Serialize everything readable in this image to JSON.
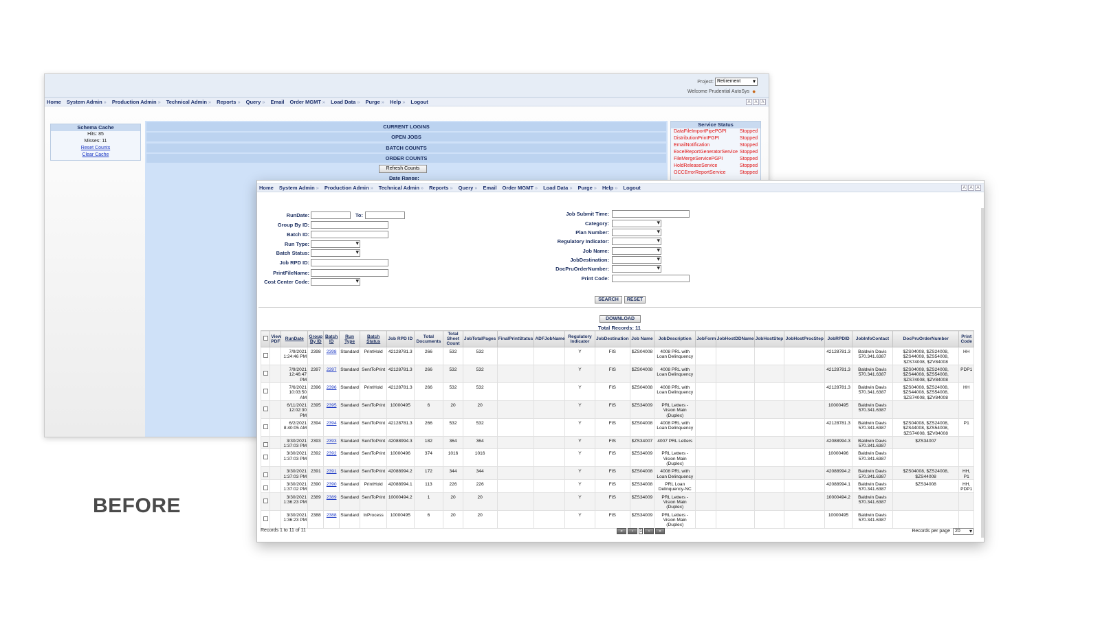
{
  "label": "BEFORE",
  "nav": [
    {
      "label": "Home",
      "arrow": false
    },
    {
      "label": "System Admin",
      "arrow": true
    },
    {
      "label": "Production Admin",
      "arrow": true
    },
    {
      "label": "Technical Admin",
      "arrow": true
    },
    {
      "label": "Reports",
      "arrow": true
    },
    {
      "label": "Query",
      "arrow": true
    },
    {
      "label": "Email",
      "arrow": false
    },
    {
      "label": "Order MGMT",
      "arrow": true
    },
    {
      "label": "Load Data",
      "arrow": true
    },
    {
      "label": "Purge",
      "arrow": true
    },
    {
      "label": "Help",
      "arrow": true
    },
    {
      "label": "Logout",
      "arrow": false
    }
  ],
  "back": {
    "project_label": "Project:",
    "project_value": "Retirement",
    "welcome": "Welcome  Prudential AutoSys",
    "schema_cache": {
      "title": "Schema Cache",
      "hits": "Hits: 85",
      "misses": "Misses: 11",
      "reset": "Reset Counts",
      "clear": "Clear Cache"
    },
    "bars": [
      "CURRENT LOGINS",
      "OPEN JOBS",
      "BATCH COUNTS",
      "ORDER COUNTS"
    ],
    "refresh": "Refresh Counts",
    "date_range": "Date Range:",
    "service_status": {
      "title": "Service Status",
      "services": [
        {
          "name": "DataFileImportPipePGPI",
          "status": "Stopped"
        },
        {
          "name": "DistributionPrintPGPI",
          "status": "Stopped"
        },
        {
          "name": "EmailNotification",
          "status": "Stopped"
        },
        {
          "name": "ExcelReportGeneratorService",
          "status": "Stopped"
        },
        {
          "name": "FileMergeServicePGPI",
          "status": "Stopped"
        },
        {
          "name": "HoldReleaseService",
          "status": "Stopped"
        },
        {
          "name": "OCCErrorReportService",
          "status": "Stopped"
        }
      ]
    }
  },
  "form": {
    "run_date": "RunDate:",
    "to": "To:",
    "group_by_id": "Group By ID:",
    "batch_id": "Batch ID:",
    "run_type": "Run Type:",
    "batch_status": "Batch Status:",
    "job_rpd_id": "Job RPD ID:",
    "print_file_name": "PrintFileName:",
    "cost_center_code": "Cost Center Code:",
    "job_submit_time": "Job Submit Time:",
    "category": "Category:",
    "plan_number": "Plan Number:",
    "regulatory_indicator": "Regulatory Indicator:",
    "job_name": "Job Name:",
    "job_destination": "JobDestination:",
    "doc_pru_order_number": "DocPruOrderNumber:",
    "print_code": "Print Code:",
    "search": "SEARCH",
    "reset": "RESET",
    "download": "DOWNLOAD",
    "total_records": "Total Records: 11"
  },
  "table": {
    "headers": [
      "View PDF",
      "RunDate",
      "Group By ID",
      "Batch ID",
      "Run Type",
      "Batch Status",
      "Job RPD ID",
      "Total Documents",
      "Total Sheet Count",
      "JobTotalPages",
      "FinalPrintStatus",
      "ADFJobName",
      "Regulatory Indicator",
      "JobDestination",
      "Job Name",
      "JobDescription",
      "JobForm",
      "JobHostDDName",
      "JobHostStep",
      "JobHostProcStep",
      "JobRPDID",
      "JobInfoContact",
      "DocPruOrderNumber",
      "Print Code"
    ],
    "rows": [
      {
        "date": "7/9/2021",
        "time": "1:24:46 PM",
        "group": "2398",
        "batch": "2398",
        "type": "Standard",
        "status": "PrintHold",
        "rpd": "42128781.3",
        "docs": "266",
        "sheets": "532",
        "pages": "532",
        "reg": "Y",
        "dest": "FIS",
        "job": "$ZS04008",
        "desc": "4008 PRL with Loan Delinquency",
        "rpdid": "42128781.3",
        "contact": "Baldwin Davis 570.341.6387",
        "order": "$ZS04008, $ZS24008, $ZS44008, $ZS54008, $ZS74008, $ZV84008",
        "code": "HH"
      },
      {
        "date": "7/9/2021",
        "time": "12:46:47 PM",
        "group": "2397",
        "batch": "2397",
        "type": "Standard",
        "status": "SentToPrint",
        "rpd": "42128781.3",
        "docs": "266",
        "sheets": "532",
        "pages": "532",
        "reg": "Y",
        "dest": "FIS",
        "job": "$ZS04008",
        "desc": "4008 PRL with Loan Delinquency",
        "rpdid": "42128781.3",
        "contact": "Baldwin Davis 570.341.6387",
        "order": "$ZS04008, $ZS24008, $ZS44008, $ZS54008, $ZS74008, $ZV84008",
        "code": "PDP1"
      },
      {
        "date": "7/6/2021",
        "time": "10:03:50 AM",
        "group": "2396",
        "batch": "2396",
        "type": "Standard",
        "status": "PrintHold",
        "rpd": "42128781.3",
        "docs": "266",
        "sheets": "532",
        "pages": "532",
        "reg": "Y",
        "dest": "FIS",
        "job": "$ZS04008",
        "desc": "4008 PRL with Loan Delinquency",
        "rpdid": "42128781.3",
        "contact": "Baldwin Davis 570.341.6387",
        "order": "$ZS04008, $ZS24008, $ZS44008, $ZS54008, $ZS74008, $ZV84008",
        "code": "HH"
      },
      {
        "date": "6/11/2021",
        "time": "12:02:30 PM",
        "group": "2395",
        "batch": "2395",
        "type": "Standard",
        "status": "SentToPrint",
        "rpd": "10000495",
        "docs": "6",
        "sheets": "20",
        "pages": "20",
        "reg": "Y",
        "dest": "FIS",
        "job": "$ZS34009",
        "desc": "PRL Letters - Vision Main (Duplex)",
        "rpdid": "10000495",
        "contact": "Baldwin Davis 570.341.6387",
        "order": "",
        "code": ""
      },
      {
        "date": "6/2/2021",
        "time": "8:40:05 AM",
        "group": "2394",
        "batch": "2394",
        "type": "Standard",
        "status": "SentToPrint",
        "rpd": "42128781.3",
        "docs": "266",
        "sheets": "532",
        "pages": "532",
        "reg": "Y",
        "dest": "FIS",
        "job": "$ZS04008",
        "desc": "4008 PRL with Loan Delinquency",
        "rpdid": "42128781.3",
        "contact": "Baldwin Davis 570.341.6387",
        "order": "$ZS04008, $ZS24008, $ZS44008, $ZS54008, $ZS74008, $ZV84008",
        "code": "P1"
      },
      {
        "date": "3/30/2021",
        "time": "1:37:03 PM",
        "group": "2393",
        "batch": "2393",
        "type": "Standard",
        "status": "SentToPrint",
        "rpd": "42088994.3",
        "docs": "182",
        "sheets": "364",
        "pages": "364",
        "reg": "Y",
        "dest": "FIS",
        "job": "$ZS34007",
        "desc": "4007 PRL Letters",
        "rpdid": "42088994.3",
        "contact": "Baldwin Davis 570.341.6387",
        "order": "$ZS34007",
        "code": ""
      },
      {
        "date": "3/30/2021",
        "time": "1:37:03 PM",
        "group": "2392",
        "batch": "2392",
        "type": "Standard",
        "status": "SentToPrint",
        "rpd": "10000496",
        "docs": "374",
        "sheets": "1016",
        "pages": "1016",
        "reg": "Y",
        "dest": "FIS",
        "job": "$ZS34009",
        "desc": "PRL Letters - Vision Main (Duplex)",
        "rpdid": "10000496",
        "contact": "Baldwin Davis 570.341.6387",
        "order": "",
        "code": ""
      },
      {
        "date": "3/30/2021",
        "time": "1:37:03 PM",
        "group": "2391",
        "batch": "2391",
        "type": "Standard",
        "status": "SentToPrint",
        "rpd": "42088994.2",
        "docs": "172",
        "sheets": "344",
        "pages": "344",
        "reg": "Y",
        "dest": "FIS",
        "job": "$ZS04008",
        "desc": "4008 PRL with Loan Delinquency",
        "rpdid": "42088994.2",
        "contact": "Baldwin Davis 570.341.6387",
        "order": "$ZS04008, $ZS24008, $ZS44008",
        "code": "HH, P1"
      },
      {
        "date": "3/30/2021",
        "time": "1:37:02 PM",
        "group": "2390",
        "batch": "2390",
        "type": "Standard",
        "status": "PrintHold",
        "rpd": "42088994.1",
        "docs": "113",
        "sheets": "226",
        "pages": "226",
        "reg": "Y",
        "dest": "FIS",
        "job": "$ZS34008",
        "desc": "PRL Loan Delinquency-NC",
        "rpdid": "42088994.1",
        "contact": "Baldwin Davis 570.341.6387",
        "order": "$ZS34008",
        "code": "HH, PDP1"
      },
      {
        "date": "3/30/2021",
        "time": "1:36:23 PM",
        "group": "2389",
        "batch": "2389",
        "type": "Standard",
        "status": "SentToPrint",
        "rpd": "10000494.2",
        "docs": "1",
        "sheets": "20",
        "pages": "20",
        "reg": "Y",
        "dest": "FIS",
        "job": "$ZS34009",
        "desc": "PRL Letters - Vision Main (Duplex)",
        "rpdid": "10000494.2",
        "contact": "Baldwin Davis 570.341.6387",
        "order": "",
        "code": ""
      },
      {
        "date": "3/30/2021",
        "time": "1:36:23 PM",
        "group": "2388",
        "batch": "2388",
        "type": "Standard",
        "status": "InProcess",
        "rpd": "10000495",
        "docs": "6",
        "sheets": "20",
        "pages": "20",
        "reg": "Y",
        "dest": "FIS",
        "job": "$ZS34009",
        "desc": "PRL Letters - Vision Main (Duplex)",
        "rpdid": "10000495",
        "contact": "Baldwin Davis 570.341.6387",
        "order": "",
        "code": ""
      }
    ]
  },
  "footer": {
    "records": "Records 1 to 11 of 11",
    "page": "1",
    "rpp_label": "Records per page",
    "rpp_value": "20"
  }
}
